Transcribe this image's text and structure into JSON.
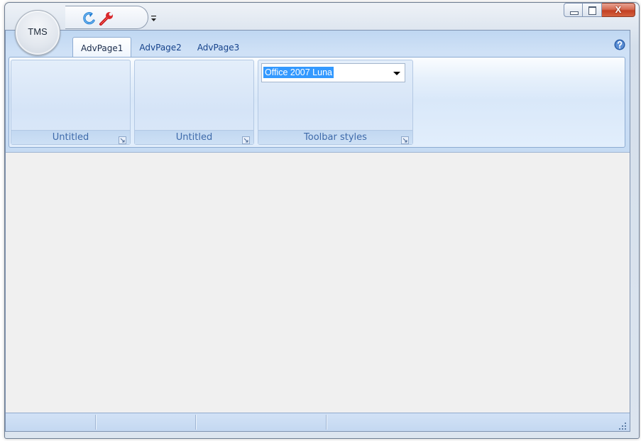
{
  "app_button": {
    "label": "TMS"
  },
  "quick_access": {
    "items": [
      {
        "name": "redo",
        "icon": "redo-arrow-icon"
      },
      {
        "name": "tools",
        "icon": "wrench-icon"
      }
    ],
    "customize_icon": "customize-dropdown-icon"
  },
  "window_controls": {
    "minimize_icon": "minimize-icon",
    "maximize_icon": "maximize-icon",
    "close_label": "X"
  },
  "ribbon": {
    "tabs": [
      {
        "label": "AdvPage1",
        "active": true
      },
      {
        "label": "AdvPage2",
        "active": false
      },
      {
        "label": "AdvPage3",
        "active": false
      }
    ],
    "help_icon": "help-icon",
    "groups": [
      {
        "caption": "Untitled"
      },
      {
        "caption": "Untitled"
      },
      {
        "caption": "Toolbar styles"
      }
    ],
    "style_combo": {
      "value": "Office 2007 Luna"
    }
  },
  "colors": {
    "ribbon_bg": "#cfe1f6",
    "tab_text": "#15428b",
    "group_caption_text": "#3e6aaa",
    "selection": "#3399ff",
    "close_button": "#c24023",
    "client_bg": "#f0f0f0"
  }
}
